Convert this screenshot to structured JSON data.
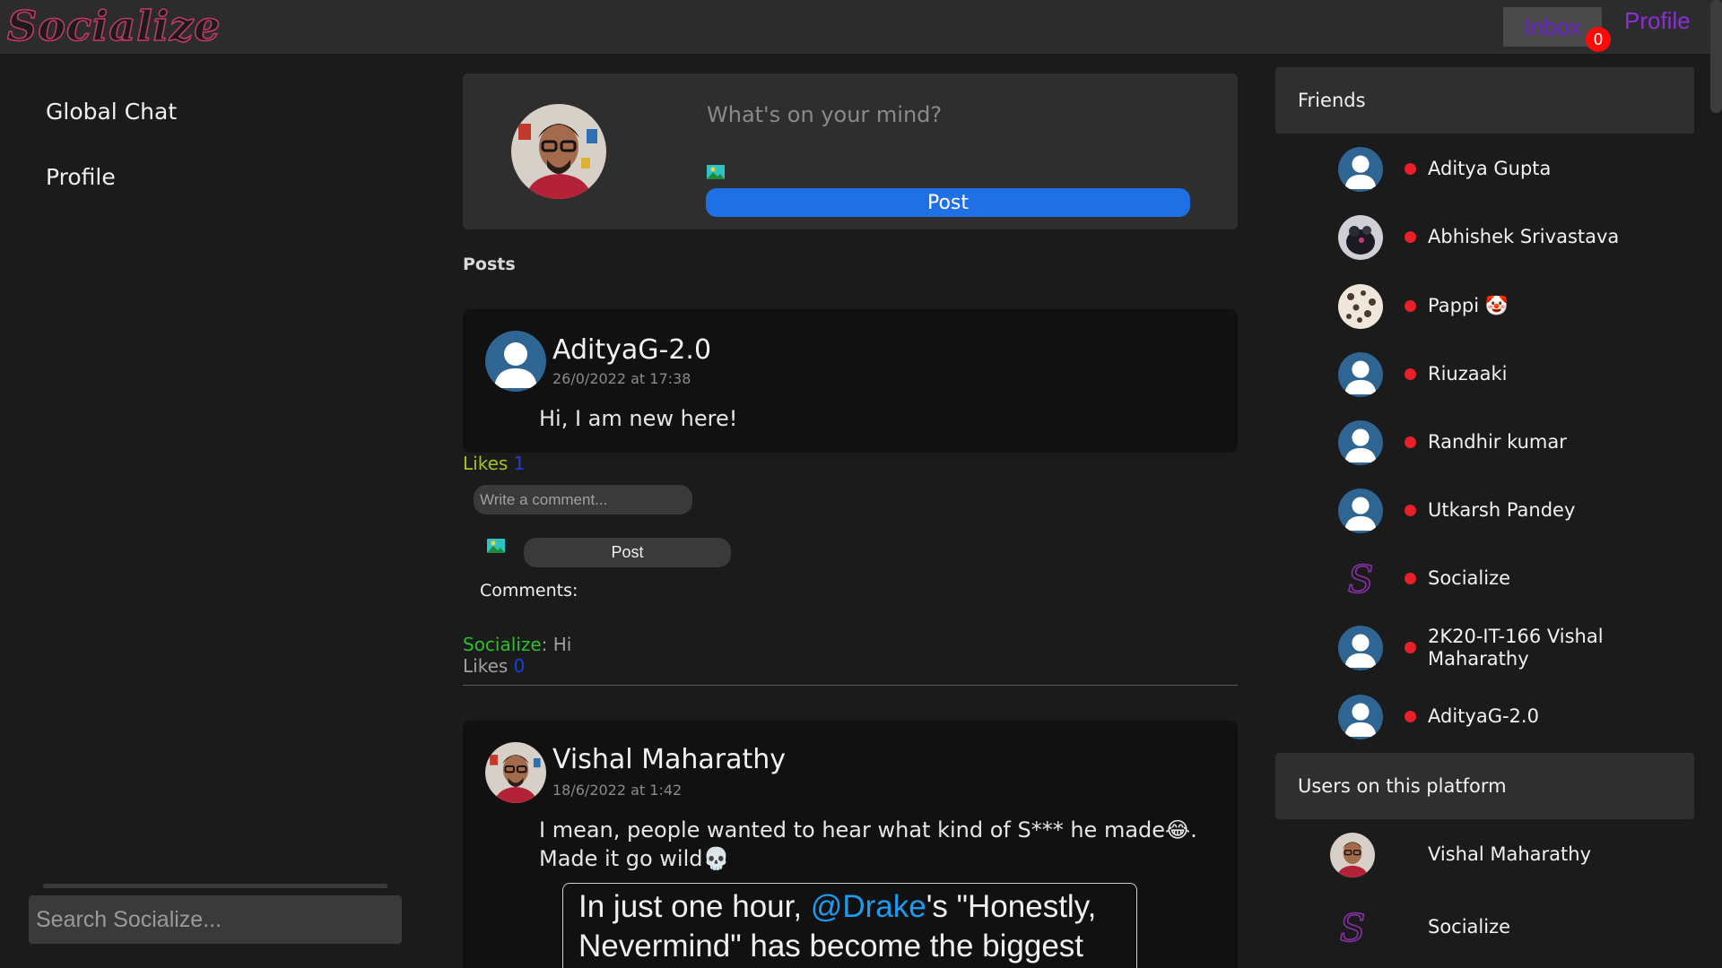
{
  "app": {
    "logo": "Socialize"
  },
  "topbar": {
    "inbox_label": "Inbox",
    "inbox_count": "0",
    "profile_label": "Profile"
  },
  "left_nav": {
    "items": [
      {
        "label": "Global Chat"
      },
      {
        "label": "Profile"
      }
    ]
  },
  "search": {
    "placeholder": "Search Socialize..."
  },
  "composer": {
    "placeholder": "What's on your mind?",
    "post_label": "Post"
  },
  "posts_heading": "Posts",
  "posts": [
    {
      "author": "AdityaG-2.0",
      "date": "26/0/2022 at 17:38",
      "text": "Hi, I am new here!",
      "likes_label": "Likes",
      "likes": "1",
      "comment_placeholder": "Write a comment...",
      "comment_post_label": "Post",
      "comments_label": "Comments:",
      "comments": [
        {
          "author": "Socialize",
          "text": "Hi",
          "likes_label": "Likes",
          "likes": "0"
        }
      ]
    },
    {
      "author": "Vishal Maharathy",
      "date": "18/6/2022 at 1:42",
      "text_line1": "I mean, people wanted to hear what kind of S*** he made😂.",
      "text_line2": "Made it go wild💀",
      "embed_pre": "In just one hour, ",
      "embed_mention": "@Drake",
      "embed_post": "'s \"Honestly, Nevermind\" has become the biggest"
    }
  ],
  "friends_heading": "Friends",
  "friends": [
    {
      "name": "Aditya Gupta",
      "avatar": "default-avatar"
    },
    {
      "name": "Abhishek Srivastava",
      "avatar": "photo-avatar"
    },
    {
      "name": "Pappi 🤡",
      "avatar": "leopard-avatar"
    },
    {
      "name": "Riuzaaki",
      "avatar": "default-avatar"
    },
    {
      "name": "Randhir kumar",
      "avatar": "default-avatar"
    },
    {
      "name": "Utkarsh Pandey",
      "avatar": "default-avatar"
    },
    {
      "name": "Socialize",
      "avatar": "socialize-logo-avatar"
    },
    {
      "name": "2K20-IT-166 Vishal Maharathy",
      "avatar": "default-avatar"
    },
    {
      "name": "AdityaG-2.0",
      "avatar": "default-avatar"
    }
  ],
  "users_heading": "Users on this platform",
  "users": [
    {
      "name": "Vishal Maharathy",
      "avatar": "photo-avatar"
    },
    {
      "name": "Socialize",
      "avatar": "socialize-logo-avatar"
    }
  ],
  "colors": {
    "accent_blue": "#1f6fe5",
    "inbox_text": "#6a1fd0",
    "profile_link": "#8b2fd6",
    "likes_label": "#a3c51a",
    "likes_count": "#1b3fd8",
    "comment_author": "#2fbe2f",
    "status_offline": "#e8202a"
  }
}
